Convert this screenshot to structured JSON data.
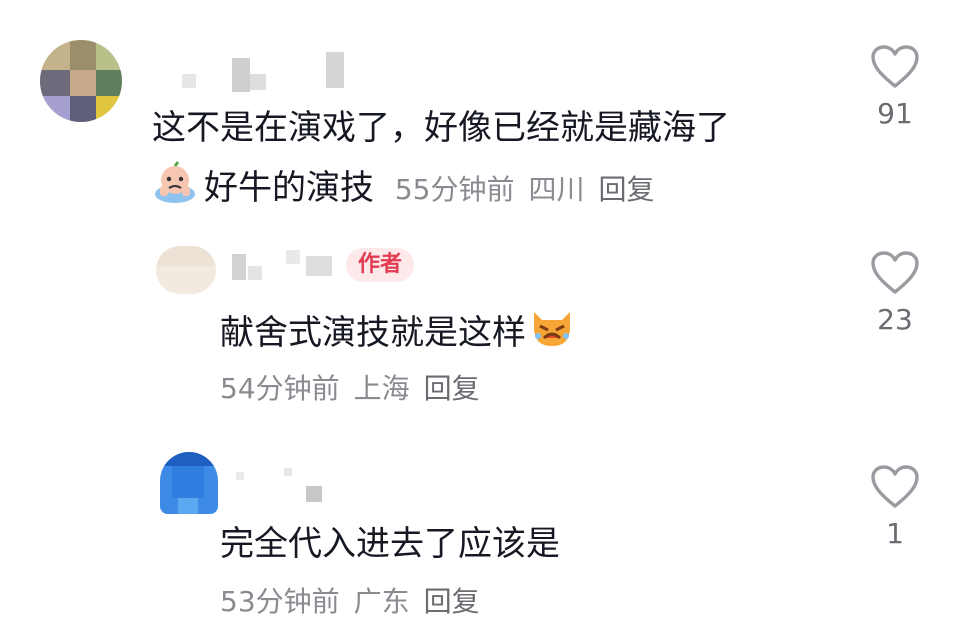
{
  "comments": [
    {
      "text_line1": "这不是在演戏了，好像已经就是藏海了",
      "text_line2": "好牛的演技",
      "emoji_icon": "crying-face-icon",
      "time": "55分钟前",
      "location": "四川",
      "reply_label": "回复",
      "like_count": "91"
    },
    {
      "author_badge": "作者",
      "text": "献舍式演技就是这样",
      "emoji_icon": "crying-cat-icon",
      "time": "54分钟前",
      "location": "上海",
      "reply_label": "回复",
      "like_count": "23"
    },
    {
      "text": "完全代入进去了应该是",
      "time": "53分钟前",
      "location": "广东",
      "reply_label": "回复",
      "like_count": "1"
    }
  ],
  "colors": {
    "text": "#161823",
    "meta": "#8a8b91",
    "badge_bg": "#fde8ea",
    "badge_text": "#e33b4f",
    "heart": "#9a9aa0"
  },
  "icons": [
    "heart-outline-icon",
    "avatar"
  ]
}
